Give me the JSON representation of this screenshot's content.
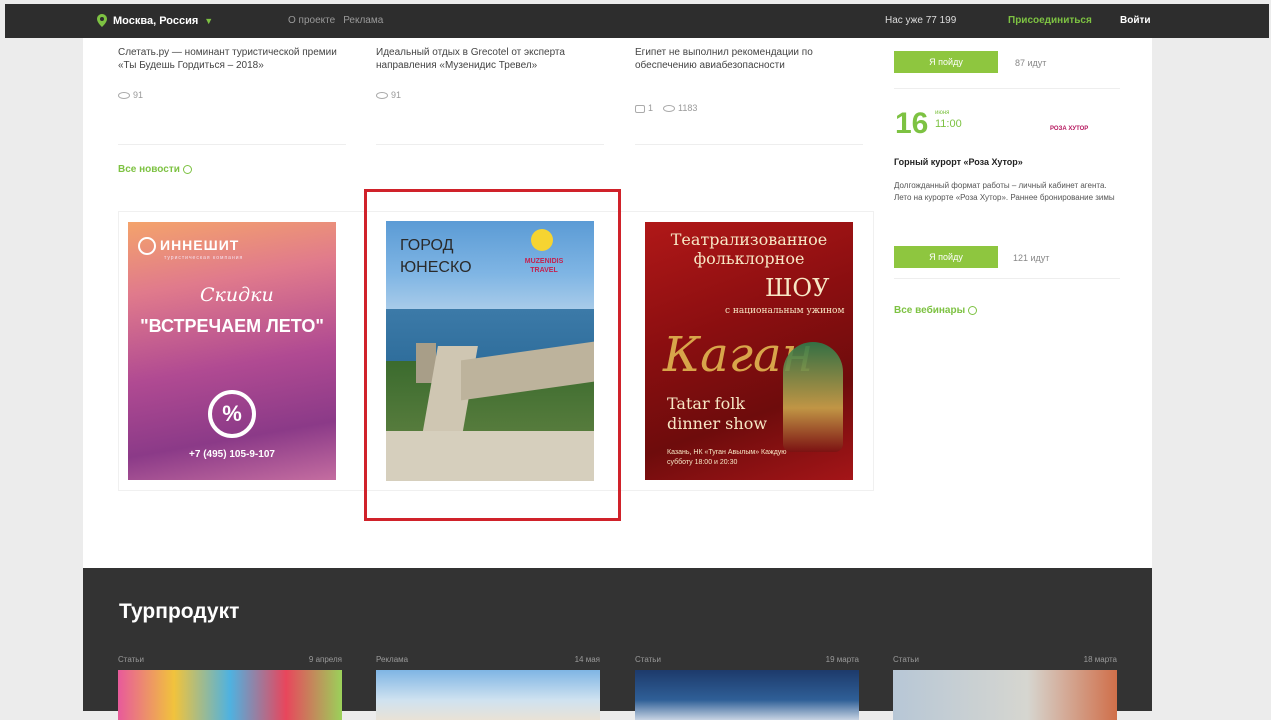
{
  "topbar": {
    "location": "Москва, Россия",
    "nav": [
      "О проекте",
      "Реклама"
    ],
    "count": "Нас уже 77 199",
    "join": "Присоединиться",
    "login": "Войти"
  },
  "news": [
    {
      "title": "Слетать.ру — номинант туристической премии «Ты Будешь Гордиться – 2018»",
      "views": "91",
      "comments": ""
    },
    {
      "title": "Идеальный отдых в Grecotel от эксперта направления «Музенидис Тревел»",
      "views": "91",
      "comments": ""
    },
    {
      "title": "Египет не выполнил рекомендации по обеспечению авиабезопасности",
      "views": "1183",
      "comments": "1"
    }
  ],
  "all_news": "Все новости",
  "banners": {
    "b1": {
      "logo": "ИННЕШИТ",
      "logo_sub": "туристическая компания",
      "script": "Скидки",
      "headline": "\"ВСТРЕЧАЕМ ЛЕТО\"",
      "pct": "%",
      "phone": "+7 (495) 105-9-107"
    },
    "b2": {
      "title": "ГОРОД ЮНЕСКО",
      "brand": "MUZENIDIS TRAVEL"
    },
    "b3": {
      "t1": "Театрализованное фольклорное",
      "t2": "ШОУ",
      "t3": "с национальным ужином",
      "kagan": "Каган",
      "t4": "Tatar folk dinner show",
      "t5": "Казань, НК «Туган Авылым» Каждую субботу 18:00 и 20:30"
    }
  },
  "webinars": {
    "first": {
      "button": "Я пойду",
      "count": "87 идут"
    },
    "second": {
      "day": "16",
      "month": "июня",
      "time": "11:00",
      "logo": "РОЗА ХУТОР",
      "title": "Горный курорт «Роза Хутор»",
      "desc": "Долгожданный формат работы – личный кабинет агента. Лето на курорте «Роза Хутор». Раннее бронирование зимы",
      "button": "Я пойду",
      "count": "121 идут"
    },
    "all": "Все вебинары"
  },
  "turproduct": {
    "heading": "Турпродукт",
    "cards": [
      {
        "type": "Статьи",
        "date": "9 апреля"
      },
      {
        "type": "Реклама",
        "date": "14 мая"
      },
      {
        "type": "Статьи",
        "date": "19 марта"
      },
      {
        "type": "Статьи",
        "date": "18 марта"
      }
    ]
  },
  "colors": {
    "accent": "#7dc242",
    "highlight": "#d0222a",
    "topbar": "#2d2d2d"
  }
}
